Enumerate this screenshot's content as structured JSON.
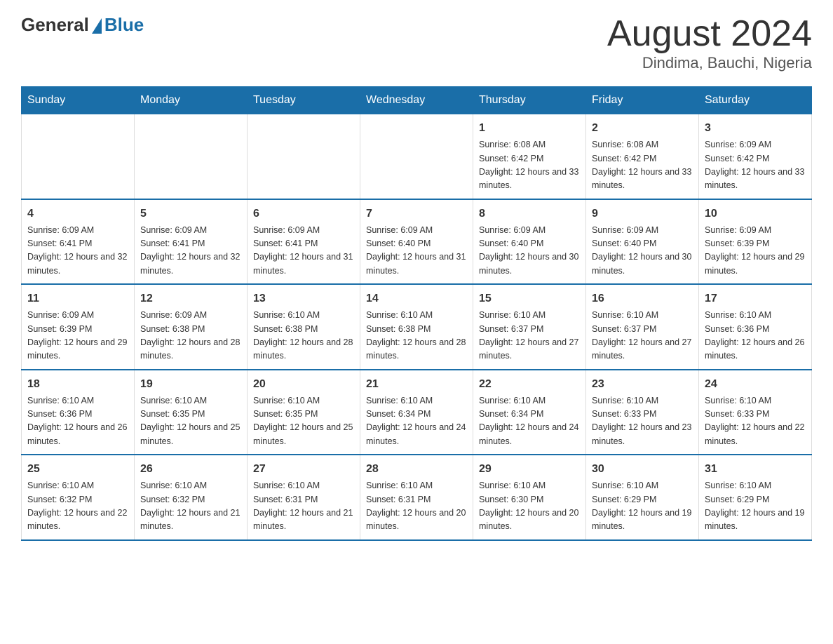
{
  "header": {
    "logo": {
      "text_general": "General",
      "text_blue": "Blue"
    },
    "title": "August 2024",
    "subtitle": "Dindima, Bauchi, Nigeria"
  },
  "calendar": {
    "days_of_week": [
      "Sunday",
      "Monday",
      "Tuesday",
      "Wednesday",
      "Thursday",
      "Friday",
      "Saturday"
    ],
    "weeks": [
      {
        "cells": [
          {
            "day": null,
            "info": null
          },
          {
            "day": null,
            "info": null
          },
          {
            "day": null,
            "info": null
          },
          {
            "day": null,
            "info": null
          },
          {
            "day": "1",
            "info": "Sunrise: 6:08 AM\nSunset: 6:42 PM\nDaylight: 12 hours and 33 minutes."
          },
          {
            "day": "2",
            "info": "Sunrise: 6:08 AM\nSunset: 6:42 PM\nDaylight: 12 hours and 33 minutes."
          },
          {
            "day": "3",
            "info": "Sunrise: 6:09 AM\nSunset: 6:42 PM\nDaylight: 12 hours and 33 minutes."
          }
        ]
      },
      {
        "cells": [
          {
            "day": "4",
            "info": "Sunrise: 6:09 AM\nSunset: 6:41 PM\nDaylight: 12 hours and 32 minutes."
          },
          {
            "day": "5",
            "info": "Sunrise: 6:09 AM\nSunset: 6:41 PM\nDaylight: 12 hours and 32 minutes."
          },
          {
            "day": "6",
            "info": "Sunrise: 6:09 AM\nSunset: 6:41 PM\nDaylight: 12 hours and 31 minutes."
          },
          {
            "day": "7",
            "info": "Sunrise: 6:09 AM\nSunset: 6:40 PM\nDaylight: 12 hours and 31 minutes."
          },
          {
            "day": "8",
            "info": "Sunrise: 6:09 AM\nSunset: 6:40 PM\nDaylight: 12 hours and 30 minutes."
          },
          {
            "day": "9",
            "info": "Sunrise: 6:09 AM\nSunset: 6:40 PM\nDaylight: 12 hours and 30 minutes."
          },
          {
            "day": "10",
            "info": "Sunrise: 6:09 AM\nSunset: 6:39 PM\nDaylight: 12 hours and 29 minutes."
          }
        ]
      },
      {
        "cells": [
          {
            "day": "11",
            "info": "Sunrise: 6:09 AM\nSunset: 6:39 PM\nDaylight: 12 hours and 29 minutes."
          },
          {
            "day": "12",
            "info": "Sunrise: 6:09 AM\nSunset: 6:38 PM\nDaylight: 12 hours and 28 minutes."
          },
          {
            "day": "13",
            "info": "Sunrise: 6:10 AM\nSunset: 6:38 PM\nDaylight: 12 hours and 28 minutes."
          },
          {
            "day": "14",
            "info": "Sunrise: 6:10 AM\nSunset: 6:38 PM\nDaylight: 12 hours and 28 minutes."
          },
          {
            "day": "15",
            "info": "Sunrise: 6:10 AM\nSunset: 6:37 PM\nDaylight: 12 hours and 27 minutes."
          },
          {
            "day": "16",
            "info": "Sunrise: 6:10 AM\nSunset: 6:37 PM\nDaylight: 12 hours and 27 minutes."
          },
          {
            "day": "17",
            "info": "Sunrise: 6:10 AM\nSunset: 6:36 PM\nDaylight: 12 hours and 26 minutes."
          }
        ]
      },
      {
        "cells": [
          {
            "day": "18",
            "info": "Sunrise: 6:10 AM\nSunset: 6:36 PM\nDaylight: 12 hours and 26 minutes."
          },
          {
            "day": "19",
            "info": "Sunrise: 6:10 AM\nSunset: 6:35 PM\nDaylight: 12 hours and 25 minutes."
          },
          {
            "day": "20",
            "info": "Sunrise: 6:10 AM\nSunset: 6:35 PM\nDaylight: 12 hours and 25 minutes."
          },
          {
            "day": "21",
            "info": "Sunrise: 6:10 AM\nSunset: 6:34 PM\nDaylight: 12 hours and 24 minutes."
          },
          {
            "day": "22",
            "info": "Sunrise: 6:10 AM\nSunset: 6:34 PM\nDaylight: 12 hours and 24 minutes."
          },
          {
            "day": "23",
            "info": "Sunrise: 6:10 AM\nSunset: 6:33 PM\nDaylight: 12 hours and 23 minutes."
          },
          {
            "day": "24",
            "info": "Sunrise: 6:10 AM\nSunset: 6:33 PM\nDaylight: 12 hours and 22 minutes."
          }
        ]
      },
      {
        "cells": [
          {
            "day": "25",
            "info": "Sunrise: 6:10 AM\nSunset: 6:32 PM\nDaylight: 12 hours and 22 minutes."
          },
          {
            "day": "26",
            "info": "Sunrise: 6:10 AM\nSunset: 6:32 PM\nDaylight: 12 hours and 21 minutes."
          },
          {
            "day": "27",
            "info": "Sunrise: 6:10 AM\nSunset: 6:31 PM\nDaylight: 12 hours and 21 minutes."
          },
          {
            "day": "28",
            "info": "Sunrise: 6:10 AM\nSunset: 6:31 PM\nDaylight: 12 hours and 20 minutes."
          },
          {
            "day": "29",
            "info": "Sunrise: 6:10 AM\nSunset: 6:30 PM\nDaylight: 12 hours and 20 minutes."
          },
          {
            "day": "30",
            "info": "Sunrise: 6:10 AM\nSunset: 6:29 PM\nDaylight: 12 hours and 19 minutes."
          },
          {
            "day": "31",
            "info": "Sunrise: 6:10 AM\nSunset: 6:29 PM\nDaylight: 12 hours and 19 minutes."
          }
        ]
      }
    ]
  }
}
